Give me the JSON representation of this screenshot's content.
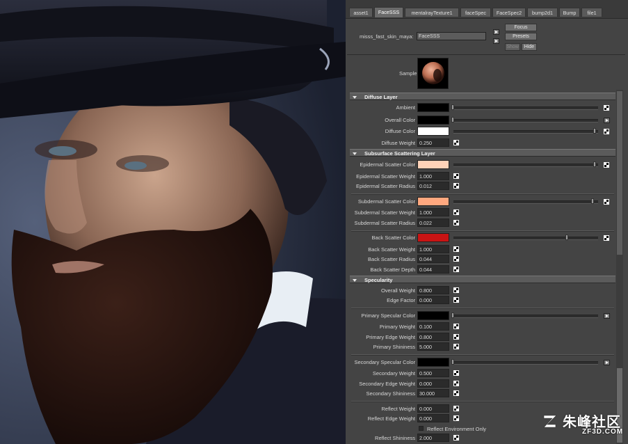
{
  "tabs": [
    "asset1",
    "FaceSSS",
    "mentalrayTexture1",
    "faceSpec",
    "FaceSpec2",
    "bump2d1",
    "Bump",
    "file1"
  ],
  "active_tab": 1,
  "header": {
    "node_type_label": "misss_fast_skin_maya:",
    "node_name": "FaceSSS",
    "focus": "Focus",
    "presets": "Presets",
    "show": "Show",
    "hide": "Hide",
    "sample_label": "Sample"
  },
  "sections": {
    "diffuse": "Diffuse Layer",
    "sss": "Subsurface Scattering Layer",
    "spec": "Specularity"
  },
  "attrs": {
    "ambient": "Ambient",
    "overall_color": "Overall Color",
    "diffuse_color": "Diffuse Color",
    "diffuse_weight": "Diffuse Weight",
    "diffuse_weight_val": "0.250",
    "epi_color": "Epidermal Scatter Color",
    "epi_weight": "Epidermal Scatter Weight",
    "epi_weight_val": "1.000",
    "epi_radius": "Epidermal Scatter Radius",
    "epi_radius_val": "0.012",
    "sub_color": "Subdermal Scatter Color",
    "sub_weight": "Subdermal Scatter Weight",
    "sub_weight_val": "1.000",
    "sub_radius": "Subdermal Scatter Radius",
    "sub_radius_val": "0.022",
    "back_color": "Back Scatter Color",
    "back_weight": "Back Scatter Weight",
    "back_weight_val": "1.000",
    "back_radius": "Back Scatter Radius",
    "back_radius_val": "0.044",
    "back_depth": "Back Scatter Depth",
    "back_depth_val": "0.044",
    "overall_weight": "Overall Weight",
    "overall_weight_val": "0.800",
    "edge_factor": "Edge Factor",
    "edge_factor_val": "0.000",
    "ps_color": "Primary Specular Color",
    "p_weight": "Primary Weight",
    "p_weight_val": "0.100",
    "p_edge": "Primary Edge Weight",
    "p_edge_val": "0.800",
    "p_shin": "Primary Shininess",
    "p_shin_val": "5.000",
    "ss_color": "Secondary Specular Color",
    "s_weight": "Secondary Weight",
    "s_weight_val": "0.500",
    "s_edge": "Secondary Edge Weight",
    "s_edge_val": "0.000",
    "s_shin": "Secondary Shininess",
    "s_shin_val": "30.000",
    "r_weight": "Reflect Weight",
    "r_weight_val": "0.000",
    "r_edge": "Reflect Edge Weight",
    "r_edge_val": "0.000",
    "r_env_only": "Reflect Environment Only",
    "r_shin": "Reflect Shininess",
    "r_shin_val": "2.000"
  },
  "colors": {
    "ambient": "#000000",
    "overall": "#000000",
    "diffuse": "#ffffff",
    "epidermal": "#ffd2b8",
    "subdermal": "#ffa87f",
    "back": "#c91414",
    "primary_spec": "#000000",
    "secondary_spec": "#000000"
  },
  "watermark": {
    "text": "朱峰社区",
    "sub": "ZF3D.COM"
  }
}
